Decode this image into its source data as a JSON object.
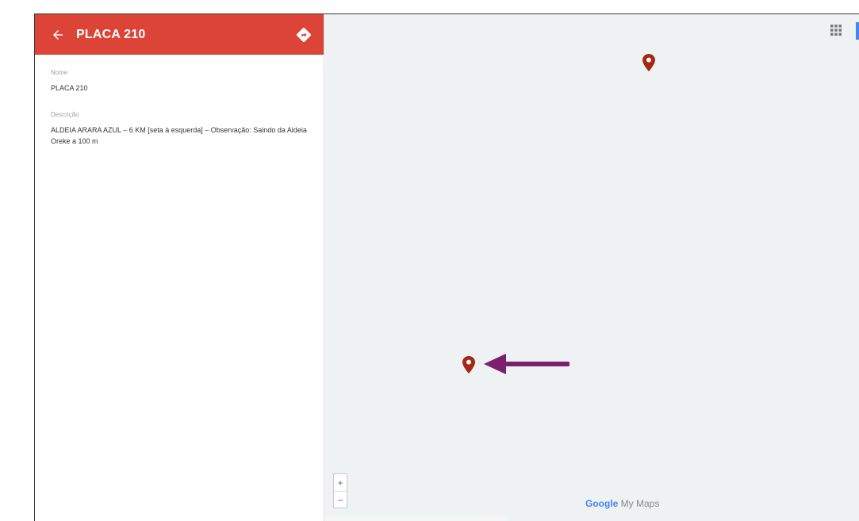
{
  "panel": {
    "title": "PLACA 210",
    "name_label": "Nome",
    "name_value": "PLACA 210",
    "description_label": "Descrição",
    "description_value": "ALDEIA ARARA AZUL – 6 KM [seta à esquerda] – Observação: Saindo da Aldeia Oreke a 100 m",
    "header_color": "#db4437"
  },
  "map": {
    "zoom_in": "+",
    "zoom_out": "−",
    "brand_google": "Google",
    "brand_suffix": " My Maps",
    "pin_color": "#a52714",
    "arrow_color": "#7b1f6e",
    "background_color": "#eef2f2"
  },
  "icons": {
    "back": "arrow-left-icon",
    "directions": "directions-icon",
    "grid": "grid-icon",
    "pin": "map-pin-icon"
  }
}
